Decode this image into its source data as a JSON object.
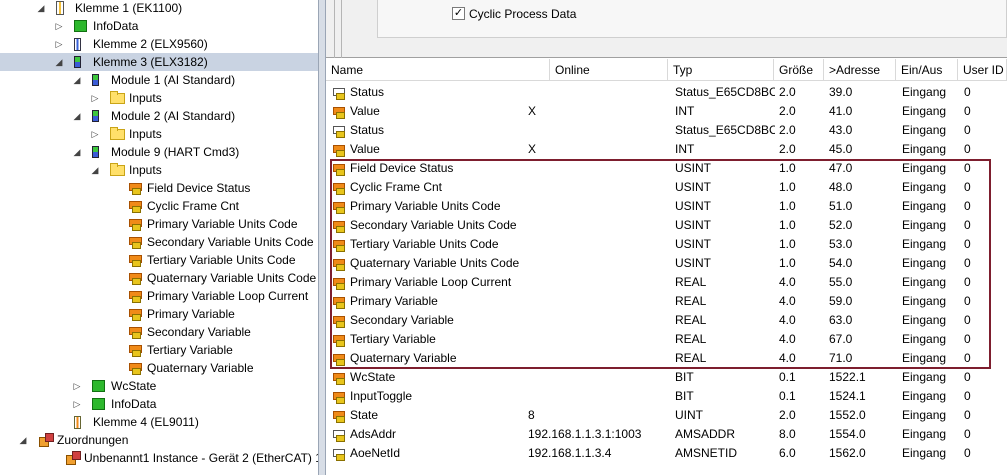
{
  "tree": [
    {
      "label": "Klemme 1 (EK1100)",
      "indent": 0,
      "tw": "◢",
      "icon": "ic-term",
      "sel": false
    },
    {
      "label": "InfoData",
      "indent": 1,
      "tw": "▷",
      "icon": "ic-green",
      "sel": false
    },
    {
      "label": "Klemme 2 (ELX9560)",
      "indent": 1,
      "tw": "▷",
      "icon": "ic-blue",
      "sel": false
    },
    {
      "label": "Klemme 3 (ELX3182)",
      "indent": 1,
      "tw": "◢",
      "icon": "ic-mod",
      "sel": true
    },
    {
      "label": "Module 1 (AI Standard)",
      "indent": 2,
      "tw": "◢",
      "icon": "ic-mod",
      "sel": false
    },
    {
      "label": "Inputs",
      "indent": 3,
      "tw": "▷",
      "icon": "ic-folder",
      "sel": false
    },
    {
      "label": "Module 2 (AI Standard)",
      "indent": 2,
      "tw": "◢",
      "icon": "ic-mod",
      "sel": false
    },
    {
      "label": "Inputs",
      "indent": 3,
      "tw": "▷",
      "icon": "ic-folder",
      "sel": false
    },
    {
      "label": "Module 9 (HART Cmd3)",
      "indent": 2,
      "tw": "◢",
      "icon": "ic-mod",
      "sel": false
    },
    {
      "label": "Inputs",
      "indent": 3,
      "tw": "◢",
      "icon": "ic-folder",
      "sel": false
    },
    {
      "label": "Field Device Status",
      "indent": 4,
      "tw": "",
      "icon": "ic-var",
      "sel": false
    },
    {
      "label": "Cyclic Frame Cnt",
      "indent": 4,
      "tw": "",
      "icon": "ic-var",
      "sel": false
    },
    {
      "label": "Primary Variable Units Code",
      "indent": 4,
      "tw": "",
      "icon": "ic-var",
      "sel": false
    },
    {
      "label": "Secondary Variable Units Code",
      "indent": 4,
      "tw": "",
      "icon": "ic-var",
      "sel": false
    },
    {
      "label": "Tertiary Variable Units Code",
      "indent": 4,
      "tw": "",
      "icon": "ic-var",
      "sel": false
    },
    {
      "label": "Quaternary Variable Units Code",
      "indent": 4,
      "tw": "",
      "icon": "ic-var",
      "sel": false
    },
    {
      "label": "Primary Variable Loop Current",
      "indent": 4,
      "tw": "",
      "icon": "ic-var",
      "sel": false
    },
    {
      "label": "Primary Variable",
      "indent": 4,
      "tw": "",
      "icon": "ic-var",
      "sel": false
    },
    {
      "label": "Secondary Variable",
      "indent": 4,
      "tw": "",
      "icon": "ic-var",
      "sel": false
    },
    {
      "label": "Tertiary Variable",
      "indent": 4,
      "tw": "",
      "icon": "ic-var",
      "sel": false
    },
    {
      "label": "Quaternary Variable",
      "indent": 4,
      "tw": "",
      "icon": "ic-var",
      "sel": false
    },
    {
      "label": "WcState",
      "indent": 2,
      "tw": "▷",
      "icon": "ic-green",
      "sel": false
    },
    {
      "label": "InfoData",
      "indent": 2,
      "tw": "▷",
      "icon": "ic-green",
      "sel": false
    },
    {
      "label": "Klemme 4 (EL9011)",
      "indent": 1,
      "tw": "",
      "icon": "ic-orange",
      "sel": false
    },
    {
      "label": "Zuordnungen",
      "indent": -1,
      "tw": "◢",
      "icon": "ic-assign",
      "sel": false
    },
    {
      "label": "Unbenannt1 Instance - Gerät 2 (EtherCAT) 1",
      "indent": 0.5,
      "tw": "",
      "icon": "ic-assign",
      "sel": false
    }
  ],
  "cyclic_label": "Cyclic Process Data",
  "cyclic_checked": "✓",
  "columns": [
    "Name",
    "Online",
    "Typ",
    "Größe",
    ">Adresse",
    "Ein/Aus",
    "User ID"
  ],
  "rows": [
    {
      "name": "Status",
      "online": "",
      "typ": "Status_E65CD8BC",
      "size": "2.0",
      "addr": "39.0",
      "io": "Eingang",
      "uid": "0"
    },
    {
      "name": "Value",
      "online": "X",
      "typ": "INT",
      "size": "2.0",
      "addr": "41.0",
      "io": "Eingang",
      "uid": "0"
    },
    {
      "name": "Status",
      "online": "",
      "typ": "Status_E65CD8BC",
      "size": "2.0",
      "addr": "43.0",
      "io": "Eingang",
      "uid": "0"
    },
    {
      "name": "Value",
      "online": "X",
      "typ": "INT",
      "size": "2.0",
      "addr": "45.0",
      "io": "Eingang",
      "uid": "0"
    },
    {
      "name": "Field Device Status",
      "online": "",
      "typ": "USINT",
      "size": "1.0",
      "addr": "47.0",
      "io": "Eingang",
      "uid": "0"
    },
    {
      "name": "Cyclic Frame Cnt",
      "online": "",
      "typ": "USINT",
      "size": "1.0",
      "addr": "48.0",
      "io": "Eingang",
      "uid": "0"
    },
    {
      "name": "Primary Variable Units Code",
      "online": "",
      "typ": "USINT",
      "size": "1.0",
      "addr": "51.0",
      "io": "Eingang",
      "uid": "0"
    },
    {
      "name": "Secondary Variable Units Code",
      "online": "",
      "typ": "USINT",
      "size": "1.0",
      "addr": "52.0",
      "io": "Eingang",
      "uid": "0"
    },
    {
      "name": "Tertiary Variable Units Code",
      "online": "",
      "typ": "USINT",
      "size": "1.0",
      "addr": "53.0",
      "io": "Eingang",
      "uid": "0"
    },
    {
      "name": "Quaternary Variable Units Code",
      "online": "",
      "typ": "USINT",
      "size": "1.0",
      "addr": "54.0",
      "io": "Eingang",
      "uid": "0"
    },
    {
      "name": "Primary Variable Loop Current",
      "online": "",
      "typ": "REAL",
      "size": "4.0",
      "addr": "55.0",
      "io": "Eingang",
      "uid": "0"
    },
    {
      "name": "Primary Variable",
      "online": "",
      "typ": "REAL",
      "size": "4.0",
      "addr": "59.0",
      "io": "Eingang",
      "uid": "0"
    },
    {
      "name": "Secondary Variable",
      "online": "",
      "typ": "REAL",
      "size": "4.0",
      "addr": "63.0",
      "io": "Eingang",
      "uid": "0"
    },
    {
      "name": "Tertiary Variable",
      "online": "",
      "typ": "REAL",
      "size": "4.0",
      "addr": "67.0",
      "io": "Eingang",
      "uid": "0"
    },
    {
      "name": "Quaternary Variable",
      "online": "",
      "typ": "REAL",
      "size": "4.0",
      "addr": "71.0",
      "io": "Eingang",
      "uid": "0"
    },
    {
      "name": "WcState",
      "online": "",
      "typ": "BIT",
      "size": "0.1",
      "addr": "1522.1",
      "io": "Eingang",
      "uid": "0"
    },
    {
      "name": "InputToggle",
      "online": "",
      "typ": "BIT",
      "size": "0.1",
      "addr": "1524.1",
      "io": "Eingang",
      "uid": "0"
    },
    {
      "name": "State",
      "online": "8",
      "typ": "UINT",
      "size": "2.0",
      "addr": "1552.0",
      "io": "Eingang",
      "uid": "0"
    },
    {
      "name": "AdsAddr",
      "online": "192.168.1.1.3.1:1003",
      "typ": "AMSADDR",
      "size": "8.0",
      "addr": "1554.0",
      "io": "Eingang",
      "uid": "0"
    },
    {
      "name": "AoeNetId",
      "online": "192.168.1.1.3.4",
      "typ": "AMSNETID",
      "size": "6.0",
      "addr": "1562.0",
      "io": "Eingang",
      "uid": "0"
    }
  ]
}
